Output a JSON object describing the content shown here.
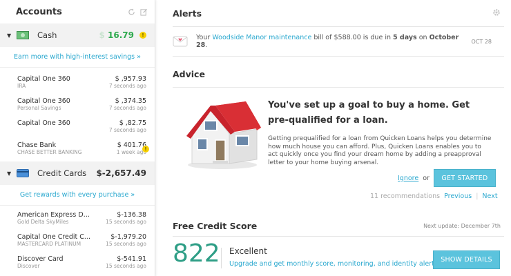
{
  "sidebar": {
    "title": "Accounts",
    "groups": {
      "cash": {
        "label": "Cash",
        "total_prefix": "$",
        "total": "16.79",
        "promo": "Earn more with high-interest savings »",
        "accounts": [
          {
            "name": "Capital One 360",
            "sub": "IRA",
            "amount": "$ ,957.93",
            "time": "7 seconds ago"
          },
          {
            "name": "Capital One 360",
            "sub": "Personal Savings",
            "amount": "$ ,374.35",
            "time": "7 seconds ago"
          },
          {
            "name": "Capital One 360",
            "sub": "",
            "amount": "$ ,82.75",
            "time": "7 seconds ago"
          },
          {
            "name": "Chase Bank",
            "sub": "CHASE BETTER BANKING",
            "amount": "$ 401.76",
            "time": "1 week ago"
          }
        ]
      },
      "credit": {
        "label": "Credit Cards",
        "total": "$-2,657.49",
        "promo": "Get rewards with every purchase »",
        "accounts": [
          {
            "name": "American Express De...",
            "sub": "Gold Delta SkyMiles",
            "amount": "$-136.38",
            "time": "15 seconds ago"
          },
          {
            "name": "Capital One Credit C...",
            "sub": "MASTERCARD PLATINUM",
            "amount": "$-1,979.20",
            "time": "15 seconds ago"
          },
          {
            "name": "Discover Card",
            "sub": "Discover",
            "amount": "$-541.91",
            "time": "15 seconds ago"
          }
        ]
      }
    }
  },
  "alerts": {
    "title": "Alerts",
    "item": {
      "prefix": "Your",
      "link": "Woodside Manor maintenance",
      "middle": "bill of $588.00 is due in",
      "days": "5 days",
      "on": "on",
      "date_bold": "October 28",
      "end": ".",
      "date": "OCT 28"
    }
  },
  "advice": {
    "title": "Advice",
    "headline": "You've set up a goal to buy a home. Get pre-qualified for a loan.",
    "body": "Getting prequalified for a loan from Quicken Loans helps you determine how much house you can afford. Plus, Quicken Loans enables you to act quickly once you find your dream home by adding a preapproval letter to your home buying arsenal.",
    "ignore": "Ignore",
    "or": "or",
    "cta": "GET STARTED",
    "count": "11 recommendations",
    "previous": "Previous",
    "next": "Next"
  },
  "credit": {
    "title": "Free Credit Score",
    "next_update": "Next update: December 7th",
    "score": "822",
    "rating": "Excellent",
    "upgrade": "Upgrade and get monthly score, monitoring, and identity alerts",
    "cta": "SHOW DETAILS"
  },
  "colors": {
    "accent": "#2aa8cf",
    "button": "#5bc3dd",
    "score": "#2e9e86",
    "positive": "#2eaa4e",
    "warning": "#f7d000"
  }
}
